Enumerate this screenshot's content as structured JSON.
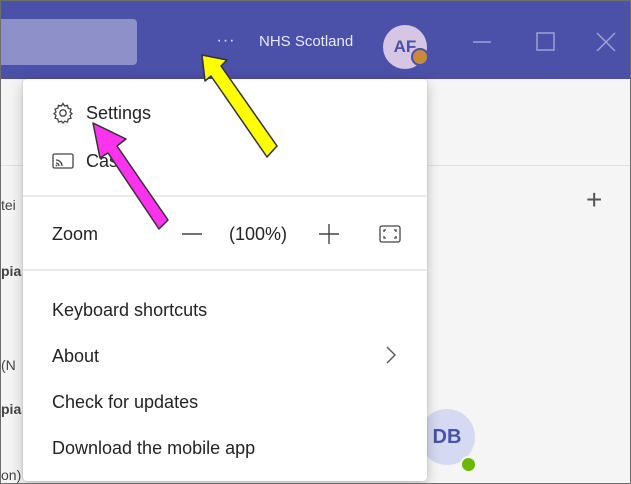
{
  "titlebar": {
    "more_label": "···",
    "org_name": "NHS Scotland",
    "avatar_initials": "AF"
  },
  "background": {
    "fragments": [
      "tei",
      "pia",
      "(N",
      "pia",
      "on)"
    ],
    "contact_initials": "DB"
  },
  "menu": {
    "settings": "Settings",
    "cast": "Cast",
    "zoom_label": "Zoom",
    "zoom_value": "(100%)",
    "keyboard_shortcuts": "Keyboard shortcuts",
    "about": "About",
    "check_updates": "Check for updates",
    "download_app": "Download the mobile app"
  },
  "colors": {
    "titlebar": "#4b50a8",
    "yellow_arrow": "#ffff00",
    "magenta_arrow": "#ff33ee"
  },
  "icons": [
    "gear-icon",
    "cast-icon",
    "minus-icon",
    "plus-icon",
    "fullscreen-icon",
    "chevron-right-icon"
  ]
}
